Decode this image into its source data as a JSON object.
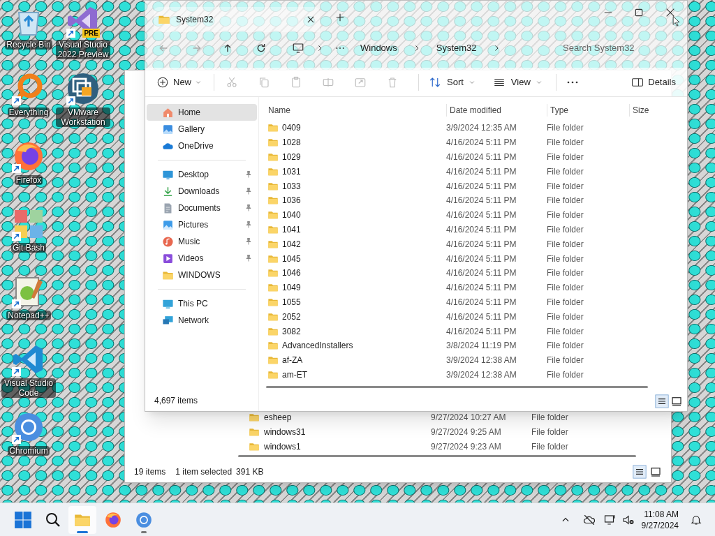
{
  "desktop_icons": [
    {
      "label": "Recycle Bin",
      "kind": "recycle",
      "shortcut": false
    },
    {
      "label": "Everything",
      "kind": "everything",
      "shortcut": true
    },
    {
      "label": "Firefox",
      "kind": "firefox",
      "shortcut": true
    },
    {
      "label": "Git Bash",
      "kind": "git",
      "shortcut": true
    },
    {
      "label": "Notepad++",
      "kind": "notepad",
      "shortcut": true
    },
    {
      "label": "Visual Studio Code",
      "kind": "vscode",
      "shortcut": true
    },
    {
      "label": "Chromium",
      "kind": "chromium",
      "shortcut": true
    },
    {
      "label": "Visual Studio 2022 Preview",
      "kind": "vs",
      "shortcut": true,
      "badge": "PRE"
    },
    {
      "label": "VMware Workstation",
      "kind": "vmware",
      "shortcut": true
    }
  ],
  "back_window": {
    "rows": [
      {
        "name": "esheep",
        "date": "9/27/2024 10:27 AM",
        "type": "File folder"
      },
      {
        "name": "windows31",
        "date": "9/27/2024 9:25 AM",
        "type": "File folder"
      },
      {
        "name": "windows1",
        "date": "9/27/2024 9:23 AM",
        "type": "File folder"
      }
    ],
    "status": {
      "count": "19 items",
      "selected": "1 item selected",
      "size": "391 KB"
    }
  },
  "front_window": {
    "tab_title": "System32",
    "address": [
      "Windows",
      "System32"
    ],
    "search_placeholder": "Search System32",
    "toolbar": {
      "new": "New",
      "sort": "Sort",
      "view": "View",
      "details": "Details"
    },
    "sidebar": [
      [
        {
          "label": "Home",
          "kind": "home",
          "selected": true,
          "pinned": false
        },
        {
          "label": "Gallery",
          "kind": "gallery",
          "selected": false,
          "pinned": false
        },
        {
          "label": "OneDrive",
          "kind": "onedrive",
          "selected": false,
          "pinned": false
        }
      ],
      [
        {
          "label": "Desktop",
          "kind": "desktop",
          "selected": false,
          "pinned": true
        },
        {
          "label": "Downloads",
          "kind": "downloads",
          "selected": false,
          "pinned": true
        },
        {
          "label": "Documents",
          "kind": "documents",
          "selected": false,
          "pinned": true
        },
        {
          "label": "Pictures",
          "kind": "pictures",
          "selected": false,
          "pinned": true
        },
        {
          "label": "Music",
          "kind": "music",
          "selected": false,
          "pinned": true
        },
        {
          "label": "Videos",
          "kind": "videos",
          "selected": false,
          "pinned": true
        },
        {
          "label": "WINDOWS",
          "kind": "folder",
          "selected": false,
          "pinned": false
        }
      ],
      [
        {
          "label": "This PC",
          "kind": "pc",
          "selected": false,
          "pinned": false
        },
        {
          "label": "Network",
          "kind": "network",
          "selected": false,
          "pinned": false
        }
      ]
    ],
    "columns": [
      "Name",
      "Date modified",
      "Type",
      "Size"
    ],
    "rows": [
      {
        "name": "0409",
        "date": "3/9/2024 12:35 AM",
        "type": "File folder"
      },
      {
        "name": "1028",
        "date": "4/16/2024 5:11 PM",
        "type": "File folder"
      },
      {
        "name": "1029",
        "date": "4/16/2024 5:11 PM",
        "type": "File folder"
      },
      {
        "name": "1031",
        "date": "4/16/2024 5:11 PM",
        "type": "File folder"
      },
      {
        "name": "1033",
        "date": "4/16/2024 5:11 PM",
        "type": "File folder"
      },
      {
        "name": "1036",
        "date": "4/16/2024 5:11 PM",
        "type": "File folder"
      },
      {
        "name": "1040",
        "date": "4/16/2024 5:11 PM",
        "type": "File folder"
      },
      {
        "name": "1041",
        "date": "4/16/2024 5:11 PM",
        "type": "File folder"
      },
      {
        "name": "1042",
        "date": "4/16/2024 5:11 PM",
        "type": "File folder"
      },
      {
        "name": "1045",
        "date": "4/16/2024 5:11 PM",
        "type": "File folder"
      },
      {
        "name": "1046",
        "date": "4/16/2024 5:11 PM",
        "type": "File folder"
      },
      {
        "name": "1049",
        "date": "4/16/2024 5:11 PM",
        "type": "File folder"
      },
      {
        "name": "1055",
        "date": "4/16/2024 5:11 PM",
        "type": "File folder"
      },
      {
        "name": "2052",
        "date": "4/16/2024 5:11 PM",
        "type": "File folder"
      },
      {
        "name": "3082",
        "date": "4/16/2024 5:11 PM",
        "type": "File folder"
      },
      {
        "name": "AdvancedInstallers",
        "date": "3/8/2024 11:19 PM",
        "type": "File folder"
      },
      {
        "name": "af-ZA",
        "date": "3/9/2024 12:38 AM",
        "type": "File folder"
      },
      {
        "name": "am-ET",
        "date": "3/9/2024 12:38 AM",
        "type": "File folder"
      }
    ],
    "status": "4,697 items"
  },
  "taskbar": {
    "apps": [
      {
        "kind": "explorer",
        "running": true,
        "selected": true
      },
      {
        "kind": "firefox",
        "running": false,
        "selected": false
      },
      {
        "kind": "chromium",
        "running": true,
        "selected": false
      }
    ],
    "time": "11:08 AM",
    "date": "9/27/2024"
  }
}
